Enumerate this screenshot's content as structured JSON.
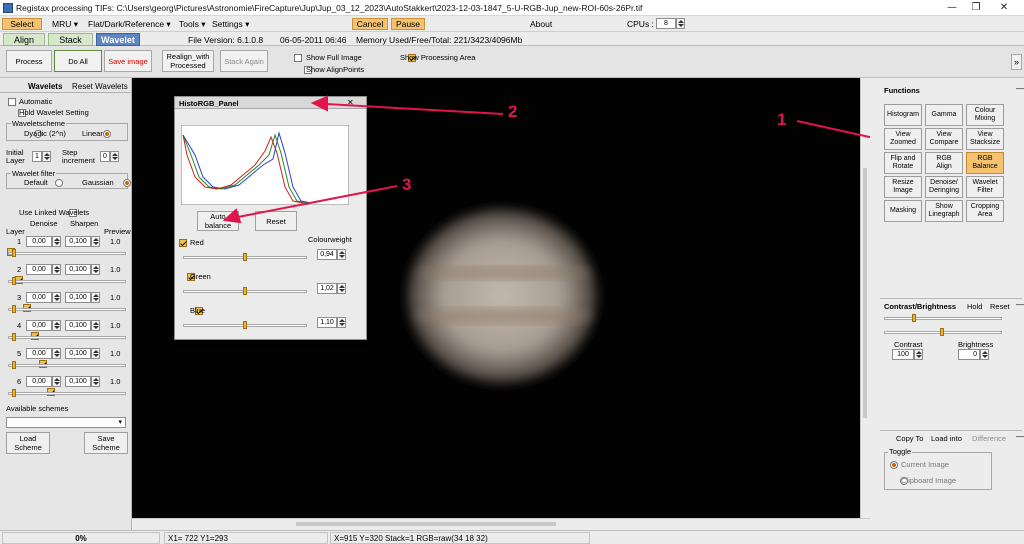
{
  "window": {
    "title": "Registax processing TIFs: C:\\Users\\georg\\Pictures\\Astronomie\\FireCapture\\Jup\\Jup_03_12_2023\\AutoStakkert\\2023-12-03-1847_5-U-RGB-Jup_new-ROI-60s-26Pr.tif"
  },
  "menu": {
    "select": "Select",
    "mru": "MRU ▾",
    "flat": "Flat/Dark/Reference ▾",
    "tools": "Tools ▾",
    "settings": "Settings ▾",
    "cancel": "Cancel",
    "pause": "Pause",
    "about": "About",
    "cpus_label": "CPUs :",
    "cpus_value": "8"
  },
  "tabs": {
    "align": "Align",
    "stack": "Stack",
    "wavelet": "Wavelet",
    "file_version": "File Version: 6.1.0.8",
    "date": "06-05-2011 06:46",
    "memory": "Memory Used/Free/Total: 221/3423/4096Mb"
  },
  "toolbar": {
    "process": "Process",
    "do_all": "Do All",
    "save_image": "Save image",
    "realign": "Realign_with\nProcessed",
    "stack_again": "Stack Again",
    "show_full_image": "Show Full Image",
    "show_alignpoints": "Show AlignPoints",
    "show_processing_area": "Show Processing Area",
    "expand": "»"
  },
  "wavelets": {
    "tab1": "Wavelets",
    "tab2": "Reset Wavelets",
    "automatic": "Automatic",
    "hold": "Hold Wavelet Setting",
    "scheme_title": "Waveletscheme",
    "dyadic": "Dyadic (2^n)",
    "linear": "Linear",
    "initial_layer_label": "Initial\nLayer",
    "initial_layer_value": "1",
    "step_label": "Step\nincrement",
    "step_value": "0",
    "filter_title": "Wavelet filter",
    "default": "Default",
    "gaussian": "Gaussian",
    "use_linked": "Use Linked Wavelets",
    "col_denoise": "Denoise",
    "col_sharpen": "Sharpen",
    "col_layer": "Layer",
    "col_preview": "Preview",
    "layers": [
      {
        "n": "1",
        "denoise": "0,00",
        "sharpen": "0,100",
        "preview": "1.0"
      },
      {
        "n": "2",
        "denoise": "0,00",
        "sharpen": "0,100",
        "preview": "1.0"
      },
      {
        "n": "3",
        "denoise": "0,00",
        "sharpen": "0,100",
        "preview": "1.0"
      },
      {
        "n": "4",
        "denoise": "0,00",
        "sharpen": "0,100",
        "preview": "1.0"
      },
      {
        "n": "5",
        "denoise": "0,00",
        "sharpen": "0,100",
        "preview": "1.0"
      },
      {
        "n": "6",
        "denoise": "0,00",
        "sharpen": "0,100",
        "preview": "1.0"
      }
    ],
    "available_schemes": "Available schemes",
    "load_scheme": "Load\nScheme",
    "save_scheme": "Save\nScheme"
  },
  "histo": {
    "title": "HistoRGB_Panel",
    "auto_balance": "Auto\nbalance",
    "reset": "Reset",
    "colourweight": "Colourweight",
    "channels": [
      {
        "name": "Red",
        "weight": "0,94",
        "slider": 0.5
      },
      {
        "name": "Green",
        "weight": "1,02",
        "slider": 0.5
      },
      {
        "name": "Blue",
        "weight": "1,10",
        "slider": 0.5
      }
    ]
  },
  "functions": {
    "title": "Functions",
    "buttons": [
      "Histogram",
      "Gamma",
      "Colour\nMixing",
      "View\nZoomed",
      "View\nCompare",
      "View\nStacksize",
      "Flip and\nRotate",
      "RGB\nAlign",
      "RGB\nBalance",
      "Resize\nImage",
      "Denoise/\nDeringing",
      "Wavelet\nFilter",
      "Masking",
      "Show\nLinegraph",
      "Cropping\nArea"
    ],
    "selected": "RGB\nBalance"
  },
  "contrast": {
    "title": "Contrast/Brightness",
    "hold": "Hold",
    "reset": "Reset",
    "contrast_label": "Contrast",
    "contrast_value": "100",
    "brightness_label": "Brightness",
    "brightness_value": "0"
  },
  "copyto": {
    "copy_to": "Copy To",
    "load_into": "Load into",
    "difference": "Difference",
    "toggle": "Toggle",
    "current_image": "Current Image",
    "clipboard_image": "Clipboard Image"
  },
  "status": {
    "progress": "0%",
    "xy": "X1= 722 Y1=293",
    "info": "X=915 Y=320 Stack=1 RGB=raw(34 18 32)"
  },
  "annotations": [
    "1",
    "2",
    "3"
  ],
  "colors": {
    "annotation": "#e0154f",
    "selected": "#f5c271",
    "wavelet_tab": "#5b86c4"
  }
}
